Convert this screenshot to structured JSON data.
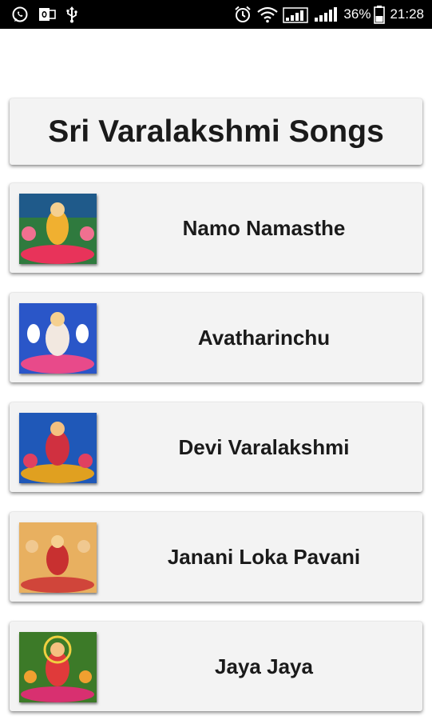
{
  "status_bar": {
    "battery_percent": "36%",
    "time": "21:28",
    "icons": [
      "whatsapp-icon",
      "outlook-icon",
      "usb-icon",
      "alarm-icon",
      "wifi-icon",
      "signal-icon",
      "signal-icon",
      "battery-icon"
    ]
  },
  "app": {
    "title": "Sri Varalakshmi Songs"
  },
  "songs": [
    {
      "label": "Namo Namasthe",
      "thumb_bg": "#2f7a3e",
      "thumb_accent": "#e8335a"
    },
    {
      "label": "Avatharinchu",
      "thumb_bg": "#2a56c8",
      "thumb_accent": "#e84a8a"
    },
    {
      "label": "Devi Varalakshmi",
      "thumb_bg": "#1f58b8",
      "thumb_accent": "#e0a020"
    },
    {
      "label": "Janani Loka Pavani",
      "thumb_bg": "#e8b060",
      "thumb_accent": "#d0453a"
    },
    {
      "label": "Jaya Jaya",
      "thumb_bg": "#3c7a28",
      "thumb_accent": "#d83070"
    }
  ],
  "colors": {
    "status_bar_bg": "#000000",
    "card_bg": "#f3f3f3",
    "text": "#1a1a1a"
  }
}
